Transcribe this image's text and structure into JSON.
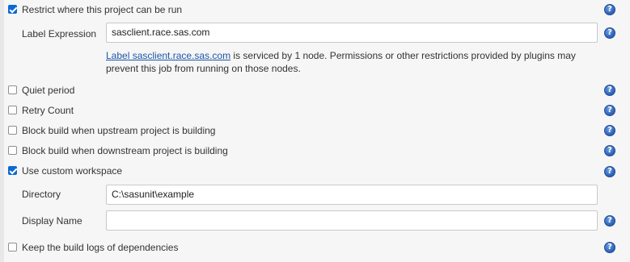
{
  "restrict": {
    "label": "Restrict where this project can be run",
    "checked": true
  },
  "label_expression": {
    "field_label": "Label Expression",
    "value": "sasclient.race.sas.com",
    "info_link": "Label sasclient.race.sas.com",
    "info_text": " is serviced by 1 node. Permissions or other restrictions provided by plugins may prevent this job from running on those nodes."
  },
  "quiet_period": {
    "label": "Quiet period",
    "checked": false
  },
  "retry_count": {
    "label": "Retry Count",
    "checked": false
  },
  "block_upstream": {
    "label": "Block build when upstream project is building",
    "checked": false
  },
  "block_downstream": {
    "label": "Block build when downstream project is building",
    "checked": false
  },
  "custom_workspace": {
    "label": "Use custom workspace",
    "checked": true
  },
  "directory": {
    "field_label": "Directory",
    "value": "C:\\sasunit\\example"
  },
  "display_name": {
    "field_label": "Display Name",
    "value": ""
  },
  "keep_logs": {
    "label": "Keep the build logs of dependencies",
    "checked": false
  },
  "help_icon": {
    "glyph": "?",
    "name": "help-icon",
    "color": "#2a5fb3"
  },
  "colors": {
    "accent": "#0b69d4",
    "link": "#1e55a8"
  }
}
